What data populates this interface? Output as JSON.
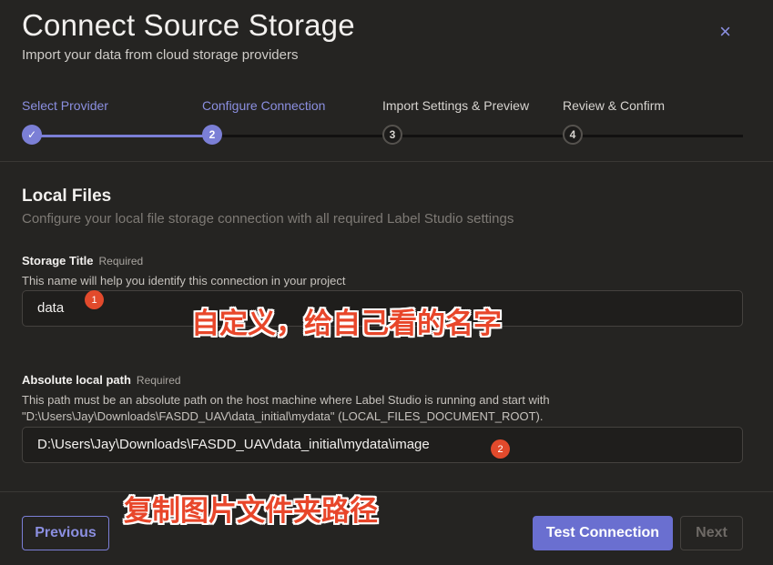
{
  "header": {
    "title": "Connect Source Storage",
    "subtitle": "Import your data from cloud storage providers",
    "close_icon": "×"
  },
  "steps": [
    {
      "label": "Select Provider",
      "state": "done",
      "marker": "✓"
    },
    {
      "label": "Configure Connection",
      "state": "current",
      "marker": "2"
    },
    {
      "label": "Import Settings & Preview",
      "state": "todo",
      "marker": "3"
    },
    {
      "label": "Review & Confirm",
      "state": "todo",
      "marker": "4"
    }
  ],
  "section": {
    "title": "Local Files",
    "subtitle": "Configure your local file storage connection with all required Label Studio settings"
  },
  "fields": {
    "storage_title": {
      "label": "Storage Title",
      "required": "Required",
      "help": "This name will help you identify this connection in your project",
      "value": "data"
    },
    "local_path": {
      "label": "Absolute local path",
      "required": "Required",
      "help_line1": "This path must be an absolute path on the host machine where Label Studio is running and start with",
      "help_line2": "\"D:\\Users\\Jay\\Downloads\\FASDD_UAV\\data_initial\\mydata\" (LOCAL_FILES_DOCUMENT_ROOT).",
      "value": "D:\\Users\\Jay\\Downloads\\FASDD_UAV\\data_initial\\mydata\\image"
    }
  },
  "annotations": {
    "badge1": "1",
    "note1": "自定义，给自己看的名字",
    "badge2": "2",
    "note2": "复制图片文件夹路径"
  },
  "footer": {
    "previous": "Previous",
    "test": "Test Connection",
    "next": "Next"
  },
  "colors": {
    "accent": "#7b7fd6",
    "background": "#252422",
    "annotation": "#e8462a"
  }
}
